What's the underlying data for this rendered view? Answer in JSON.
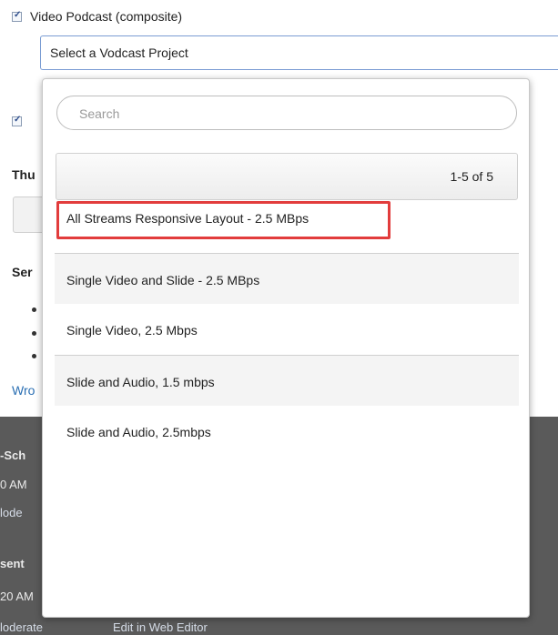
{
  "background": {
    "video_podcast_label": "Video Podcast (composite)",
    "select_value": "Select a Vodcast Project",
    "frag_thu": "Thu",
    "frag_ser": "Ser",
    "frag_wro": "Wro",
    "dark_frag1": "-Sch",
    "dark_frag2": "0 AM",
    "dark_frag3": "lode",
    "dark_frag4": "sent",
    "dark_frag5": "20 AM",
    "dark_link_moderate": "loderate",
    "dark_link_edit": "Edit in Web Editor"
  },
  "dropdown": {
    "search_placeholder": "Search",
    "pager_text": "1-5 of 5",
    "items": [
      {
        "label": "All Streams Responsive Layout - 2.5 MBps"
      },
      {
        "label": "Single Video and Slide - 2.5 MBps"
      },
      {
        "label": "Single Video, 2.5 Mbps"
      },
      {
        "label": "Slide and Audio, 1.5 mbps"
      },
      {
        "label": "Slide and Audio, 2.5mbps"
      }
    ]
  },
  "colors": {
    "highlight": "#e23c3c",
    "link": "#2a6fb3",
    "dark_band": "#5a5a5a"
  }
}
